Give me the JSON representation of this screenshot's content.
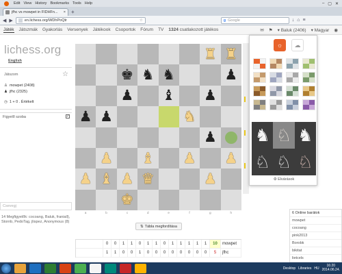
{
  "browser": {
    "menu": [
      "Edit",
      "View",
      "History",
      "Bookmarks",
      "Tools",
      "Help"
    ],
    "tab_title": "jfhc vs mowpet in FIDHFn...",
    "url": "en.lichess.org/WDhPoQtr",
    "search_placeholder": "Google"
  },
  "topnav": {
    "items": [
      "Játék",
      "Játszmák",
      "Gyakorlás",
      "Versenyek",
      "Játékook",
      "Csoportok",
      "Fórum",
      "TV"
    ],
    "online_count": "1324",
    "online_label": "csatlakozott játékos",
    "user": "Baluk (2406)",
    "language": "Magyar"
  },
  "left": {
    "logo": "lichess.org",
    "lang_link": "English",
    "game_header": "Játszom",
    "white_player": "mowpet (2408)",
    "black_player": "jfhc (2325)",
    "time_control": "1 + 0 . Értékelt",
    "chat_title": "Figyelő szoba",
    "chat_placeholder": "Csevegj",
    "spectators": "14 Megfigyelők: cocoang, Baluk, franiall), Stornb, PedoTag, jlispez, Anonymous (8)"
  },
  "board": {
    "rows": [
      [
        "",
        "",
        "",
        "",
        "",
        "",
        "wR",
        "wR"
      ],
      [
        "",
        "",
        "bK",
        "bN",
        "bN",
        "",
        "",
        "bP"
      ],
      [
        "",
        "",
        "bP",
        "",
        "bB",
        "",
        "bP",
        ""
      ],
      [
        "bP",
        "bP",
        "",
        "",
        "",
        "wN",
        "",
        ""
      ],
      [
        "",
        "",
        "",
        "",
        "",
        "",
        "bP",
        ""
      ],
      [
        "",
        "wP",
        "",
        "wB",
        "",
        "wP",
        "",
        "wP"
      ],
      [
        "wP",
        "wB",
        "wP",
        "wQ",
        "",
        "",
        "wP",
        ""
      ],
      [
        "",
        "",
        "wK",
        "",
        "",
        "",
        "",
        ""
      ]
    ],
    "last_move_square": "e5",
    "target_square": "h4",
    "files": [
      "a",
      "b",
      "c",
      "d",
      "e",
      "f",
      "g",
      "h"
    ]
  },
  "flip_label": "Tábla megfordítása",
  "scoreboard": {
    "row1": {
      "name": "mowpet",
      "results": [
        "0",
        "0",
        "1",
        "1",
        "0",
        "1",
        "1",
        "0",
        "1",
        "1",
        "1",
        "1",
        "1"
      ],
      "total": "10"
    },
    "row2": {
      "name": "jfhc",
      "results": [
        "1",
        "1",
        "0",
        "0",
        "1",
        "0",
        "0",
        "0",
        "0",
        "0",
        "0",
        "0",
        "0"
      ],
      "total": "5"
    }
  },
  "theme_panel": {
    "board_colors": [
      [
        "#e8632b",
        "#f2f2f2"
      ],
      [
        "#f0d9b5",
        "#b58863"
      ],
      [
        "#dee3e6",
        "#8ca2ad"
      ],
      [
        "#e8e8d0",
        "#a0c070"
      ],
      [
        "#f2e0c5",
        "#c49a6c"
      ],
      [
        "#d8dce4",
        "#9fa6c0"
      ],
      [
        "#ececec",
        "#a8a8a8"
      ],
      [
        "#d6e0c8",
        "#7a9a6a"
      ],
      [
        "#c79a5a",
        "#8a5a2a"
      ],
      [
        "#d8d8e0",
        "#9098a8"
      ],
      [
        "#d4e0d4",
        "#6a8a6a"
      ],
      [
        "#e8c888",
        "#b08030"
      ],
      [
        "#c8b890",
        "#808080"
      ],
      [
        "#e0e0e0",
        "#9a9a9a"
      ],
      [
        "#c8d0dc",
        "#8090a8"
      ],
      [
        "#c8a8d8",
        "#8a5aa8"
      ]
    ],
    "piece_sets": [
      "♞",
      "♘",
      "♞",
      "♘",
      "♘",
      "♘"
    ],
    "prefs_label": "Elvárások"
  },
  "online_players": {
    "header": "6 Online barátok",
    "list": [
      "mowpet",
      "cocoang",
      "pink2013",
      "Borobk",
      "bikitat",
      "lietcels"
    ]
  },
  "taskbar": {
    "desktop": "Desktop",
    "libraries": "Libraries",
    "lang": "HU",
    "time": "16:20",
    "date": "2014.06.24."
  }
}
